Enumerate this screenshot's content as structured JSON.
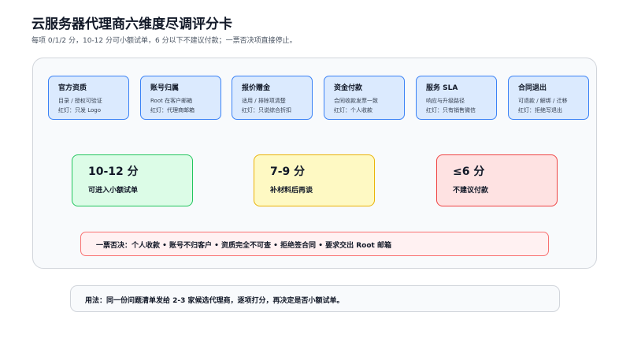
{
  "header": {
    "title": "云服务器代理商六维度尽调评分卡",
    "subtitle": "每项 0/1/2 分，10-12 分可小额试单，6 分以下不建议付款；一票否决项直接停止。"
  },
  "dimensions": [
    {
      "title": "官方资质",
      "line1": "目录 / 授权可验证",
      "line2": "红灯：只发 Logo"
    },
    {
      "title": "账号归属",
      "line1": "Root 在客户邮箱",
      "line2": "红灯：代理商邮箱"
    },
    {
      "title": "报价赠金",
      "line1": "适用 / 排除项清楚",
      "line2": "红灯：只说综合折扣"
    },
    {
      "title": "资金付款",
      "line1": "合同收款发票一致",
      "line2": "红灯：个人收款"
    },
    {
      "title": "服务 SLA",
      "line1": "响应与升级路径",
      "line2": "红灯：只有销售微信"
    },
    {
      "title": "合同退出",
      "line1": "可退款 / 解绑 / 迁移",
      "line2": "红灯：拒绝写退出"
    }
  ],
  "verdicts": [
    {
      "score": "10-12 分",
      "action": "可进入小额试单",
      "color": "#22c55e"
    },
    {
      "score": "7-9 分",
      "action": "补材料后再谈",
      "color": "#eab308"
    },
    {
      "score": "≤6 分",
      "action": "不建议付款",
      "color": "#ef4444"
    }
  ],
  "veto": "一票否决：个人收款 • 账号不归客户 • 资质完全不可查 • 拒绝签合同 • 要求交出 Root 邮箱",
  "usage": "用法：同一份问题清单发给 2-3 家候选代理商，逐项打分，再决定是否小额试单。"
}
